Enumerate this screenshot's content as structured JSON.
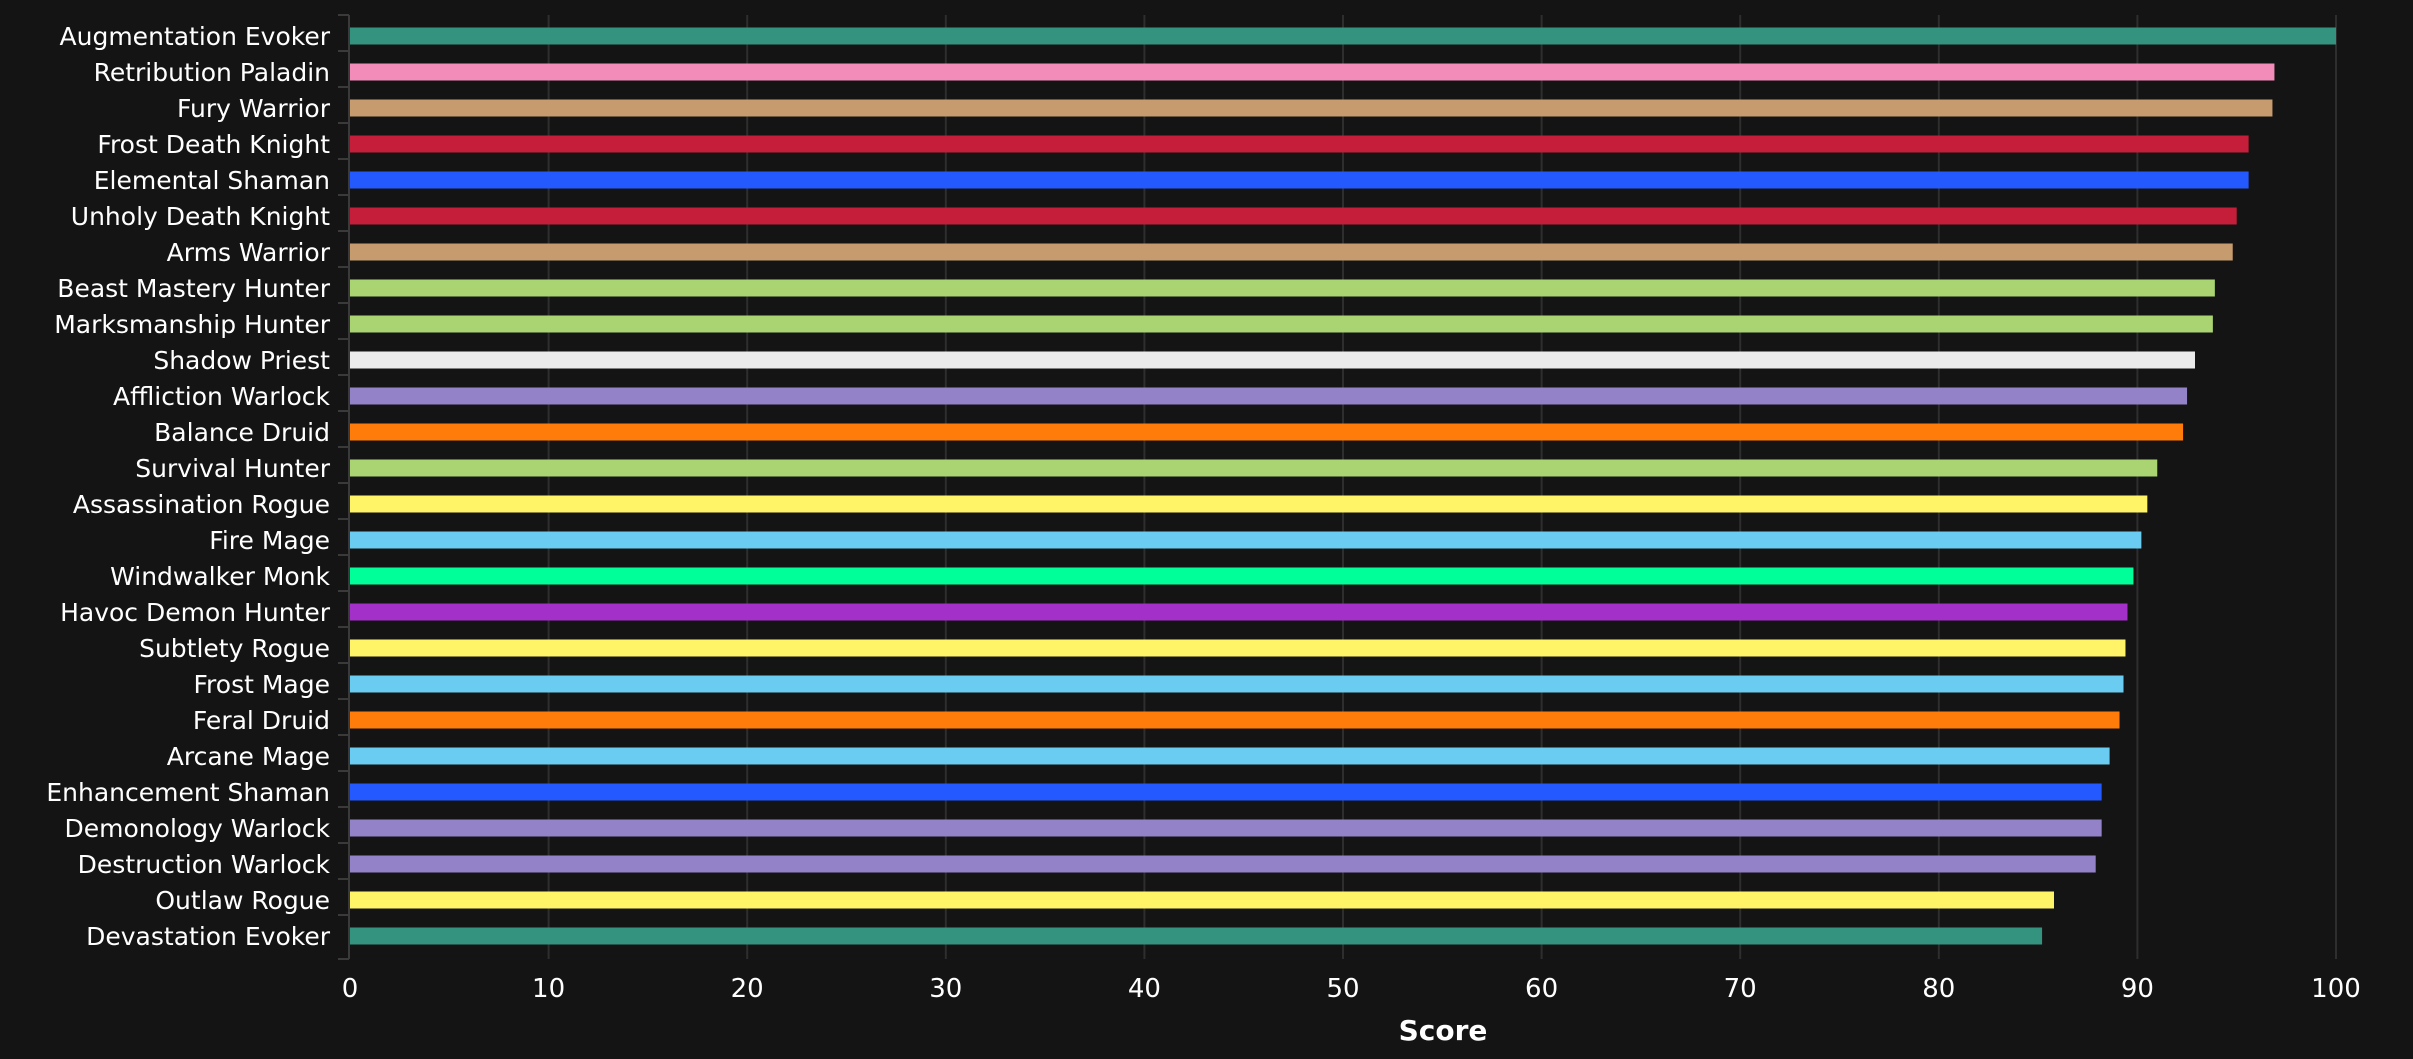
{
  "chart_data": {
    "type": "bar",
    "orientation": "horizontal",
    "title": "",
    "xlabel": "Score",
    "ylabel": "",
    "xlim": [
      0,
      100
    ],
    "xticks": [
      0,
      10,
      20,
      30,
      40,
      50,
      60,
      70,
      80,
      90,
      100
    ],
    "grid": true,
    "legend": "none",
    "categories": [
      "Augmentation Evoker",
      "Retribution Paladin",
      "Fury Warrior",
      "Frost Death Knight",
      "Elemental Shaman",
      "Unholy Death Knight",
      "Arms Warrior",
      "Beast Mastery Hunter",
      "Marksmanship Hunter",
      "Shadow Priest",
      "Affliction Warlock",
      "Balance Druid",
      "Survival Hunter",
      "Assassination Rogue",
      "Fire Mage",
      "Windwalker Monk",
      "Havoc Demon Hunter",
      "Subtlety Rogue",
      "Frost Mage",
      "Feral Druid",
      "Arcane Mage",
      "Enhancement Shaman",
      "Demonology Warlock",
      "Destruction Warlock",
      "Outlaw Rogue",
      "Devastation Evoker"
    ],
    "values": [
      100.0,
      96.9,
      96.8,
      95.6,
      95.6,
      95.0,
      94.8,
      93.9,
      93.8,
      92.9,
      92.5,
      92.3,
      91.0,
      90.5,
      90.2,
      89.8,
      89.5,
      89.4,
      89.3,
      89.1,
      88.6,
      88.2,
      88.2,
      87.9,
      85.8,
      85.2
    ],
    "colors": [
      "#33937F",
      "#F48CBA",
      "#C69B6D",
      "#C41E3A",
      "#2459FF",
      "#C41E3A",
      "#C69B6D",
      "#AAD372",
      "#AAD372",
      "#EBEBEB",
      "#9482C9",
      "#FF7C0A",
      "#AAD372",
      "#FFF468",
      "#69CCF0",
      "#00FF98",
      "#A330C9",
      "#FFF468",
      "#69CCF0",
      "#FF7C0A",
      "#69CCF0",
      "#2459FF",
      "#9482C9",
      "#9482C9",
      "#FFF468",
      "#33937F"
    ]
  },
  "theme": {
    "background": "#141414",
    "text": "#FFFFFF",
    "grid": "#2E2E2E"
  }
}
